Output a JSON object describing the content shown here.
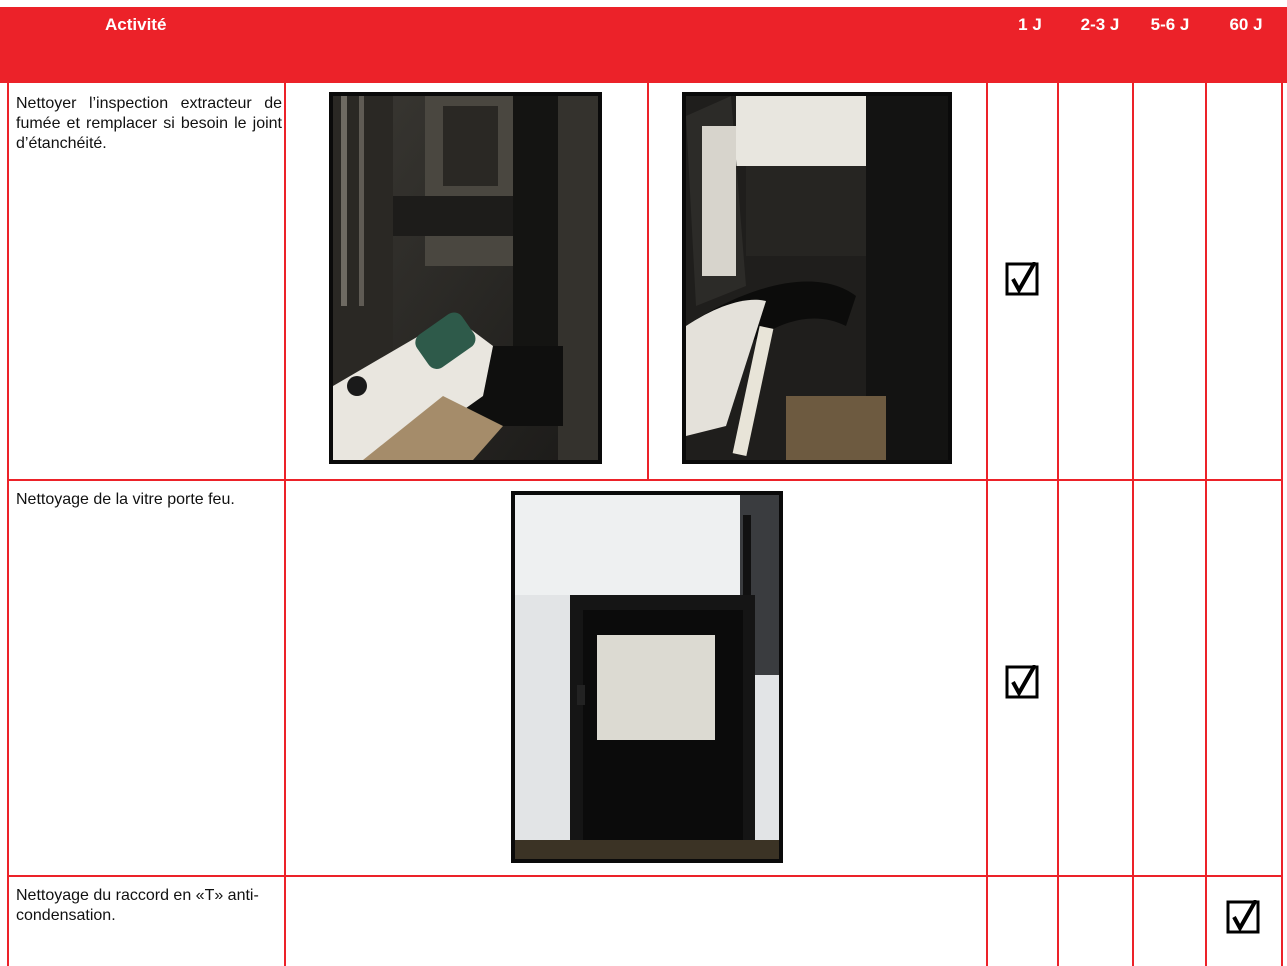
{
  "header": {
    "activity": "Activité",
    "cols": [
      "1 J",
      "2-3 J",
      "5-6 J",
      "60 J"
    ]
  },
  "rows": [
    {
      "text": "Nettoyer l’inspection extracteur de fumée et remplacer si besoin le joint d’étanchéité.",
      "checked_col": "1 J",
      "photos": [
        "smoke-extractor-inspection-photo",
        "extractor-seal-photo"
      ]
    },
    {
      "text": "Nettoyage de la vitre porte feu.",
      "checked_col": "1 J",
      "photos": [
        "fire-door-glass-photo"
      ]
    },
    {
      "text": "Nettoyage du raccord en «T» anti-condensation.",
      "checked_col": "60 J",
      "photos": []
    }
  ],
  "colors": {
    "accent": "#ec2229",
    "header_text": "#ffffff"
  },
  "icons": {
    "checkbox": "checked-box-icon"
  }
}
